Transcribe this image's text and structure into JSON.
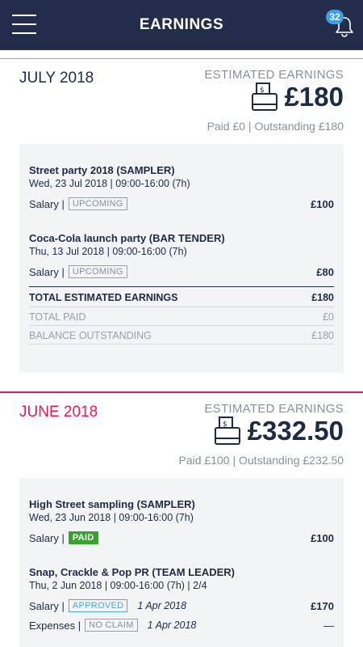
{
  "header": {
    "title": "EARNINGS",
    "notification_count": "32"
  },
  "months": [
    {
      "name": "JULY 2018",
      "estimated_label": "ESTIMATED EARNINGS",
      "amount": "£180",
      "paid_summary": "Paid £0 | Outstanding £180",
      "jobs": [
        {
          "title": "Street party 2018 (SAMPLER)",
          "date": "Wed, 23 Jul 2018 | 09:00-16:00 (7h)",
          "salary_label": "Salary |",
          "status": "UPCOMING",
          "amount": "£100"
        },
        {
          "title": "Coca-Cola launch party (BAR TENDER)",
          "date": "Thu, 13 Jul 2018 | 09:00-16:00 (7h)",
          "salary_label": "Salary |",
          "status": "UPCOMING",
          "amount": "£80"
        }
      ],
      "totals": {
        "total_label": "TOTAL ESTIMATED EARNINGS",
        "total_value": "£180",
        "paid_label": "TOTAL PAID",
        "paid_value": "£0",
        "balance_label": "BALANCE OUTSTANDING",
        "balance_value": "£180"
      }
    },
    {
      "name": "JUNE 2018",
      "estimated_label": "ESTIMATED EARNINGS",
      "amount": "£332.50",
      "paid_summary": "Paid £100 | Outstanding £232.50",
      "jobs": [
        {
          "title": "High Street sampling (SAMPLER)",
          "date": "Wed, 23 Jun 2018 | 09:00-16:00 (7h)",
          "salary_label": "Salary |",
          "status": "PAID",
          "amount": "£100"
        },
        {
          "title": "Snap, Crackle & Pop PR (TEAM LEADER)",
          "date": "Thu, 2 Jun 2018 | 09:00-16:00 (7h) | 2/4",
          "salary_label": "Salary |",
          "status": "APPROVED",
          "status_date": "1 Apr 2018",
          "amount": "£170",
          "expenses_label": "Expenses |",
          "expenses_status": "NO CLAIM",
          "expenses_date": "1 Apr 2018",
          "expenses_amount": "—"
        }
      ]
    }
  ],
  "colors": {
    "header_bg": "#232d4b",
    "accent_red": "#e8175d",
    "paid_green": "#3aa233",
    "approved_blue": "#49a8df",
    "badge_blue": "#3aa0e8"
  },
  "icons": {
    "menu": "hamburger-menu-icon",
    "notifications": "bell-icon",
    "earnings": "cash-register-icon"
  }
}
